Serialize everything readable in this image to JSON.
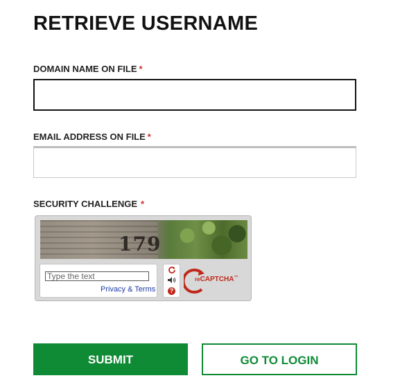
{
  "title": "RETRIEVE USERNAME",
  "required_mark": "*",
  "domain_field": {
    "label": "DOMAIN NAME ON FILE",
    "value": "",
    "placeholder": ""
  },
  "email_field": {
    "label": "EMAIL ADDRESS ON FILE",
    "value": "",
    "placeholder": ""
  },
  "security": {
    "label": "SECURITY CHALLENGE",
    "captcha_number": "179",
    "input_placeholder": "Type the text",
    "privacy_link": "Privacy & Terms",
    "logo_re": "re",
    "logo_name": "CAPTCHA",
    "logo_tm": "™",
    "icons": [
      "refresh-icon",
      "audio-icon",
      "help-icon"
    ]
  },
  "buttons": {
    "submit": "SUBMIT",
    "go_to_login": "GO TO LOGIN"
  },
  "colors": {
    "accent": "#0f8a35",
    "required": "#d32f2f",
    "recaptcha": "#c0281c"
  }
}
